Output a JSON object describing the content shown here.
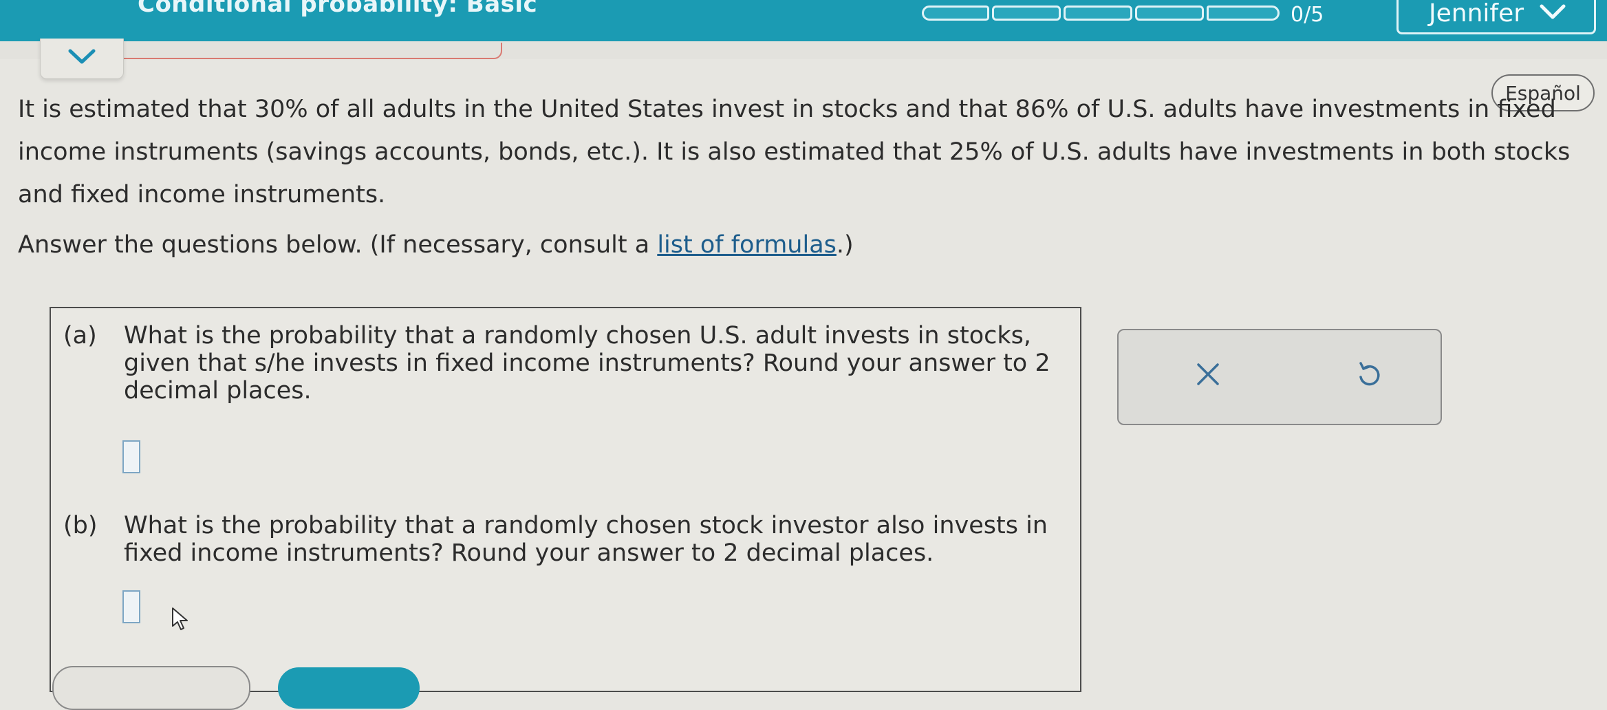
{
  "header": {
    "topic": "Conditional probability: Basic",
    "score": "0/5",
    "user": "Jennifer",
    "accent": "#1b9bb3"
  },
  "language_button": "Español",
  "problem": {
    "text": "It is estimated that 30% of all adults in the United States invest in stocks and that 86% of U.S. adults have investments in fixed income instruments (savings accounts, bonds, etc.). It is also estimated that 25% of U.S. adults have investments in both stocks and fixed income instruments.",
    "instructions_before": "Answer the questions below. (If necessary, consult a ",
    "formula_link": "list of formulas",
    "instructions_after": ".)"
  },
  "questions": [
    {
      "label": "(a)",
      "text": "What is the probability that a randomly chosen U.S. adult invests in stocks, given that s/he invests in fixed income instruments? Round your answer to 2 decimal places.",
      "answer": ""
    },
    {
      "label": "(b)",
      "text": "What is the probability that a randomly chosen stock investor also invests in fixed income instruments? Round your answer to 2 decimal places.",
      "answer": ""
    }
  ],
  "actions": {
    "clear_icon": "x-icon",
    "undo_icon": "undo-icon"
  }
}
